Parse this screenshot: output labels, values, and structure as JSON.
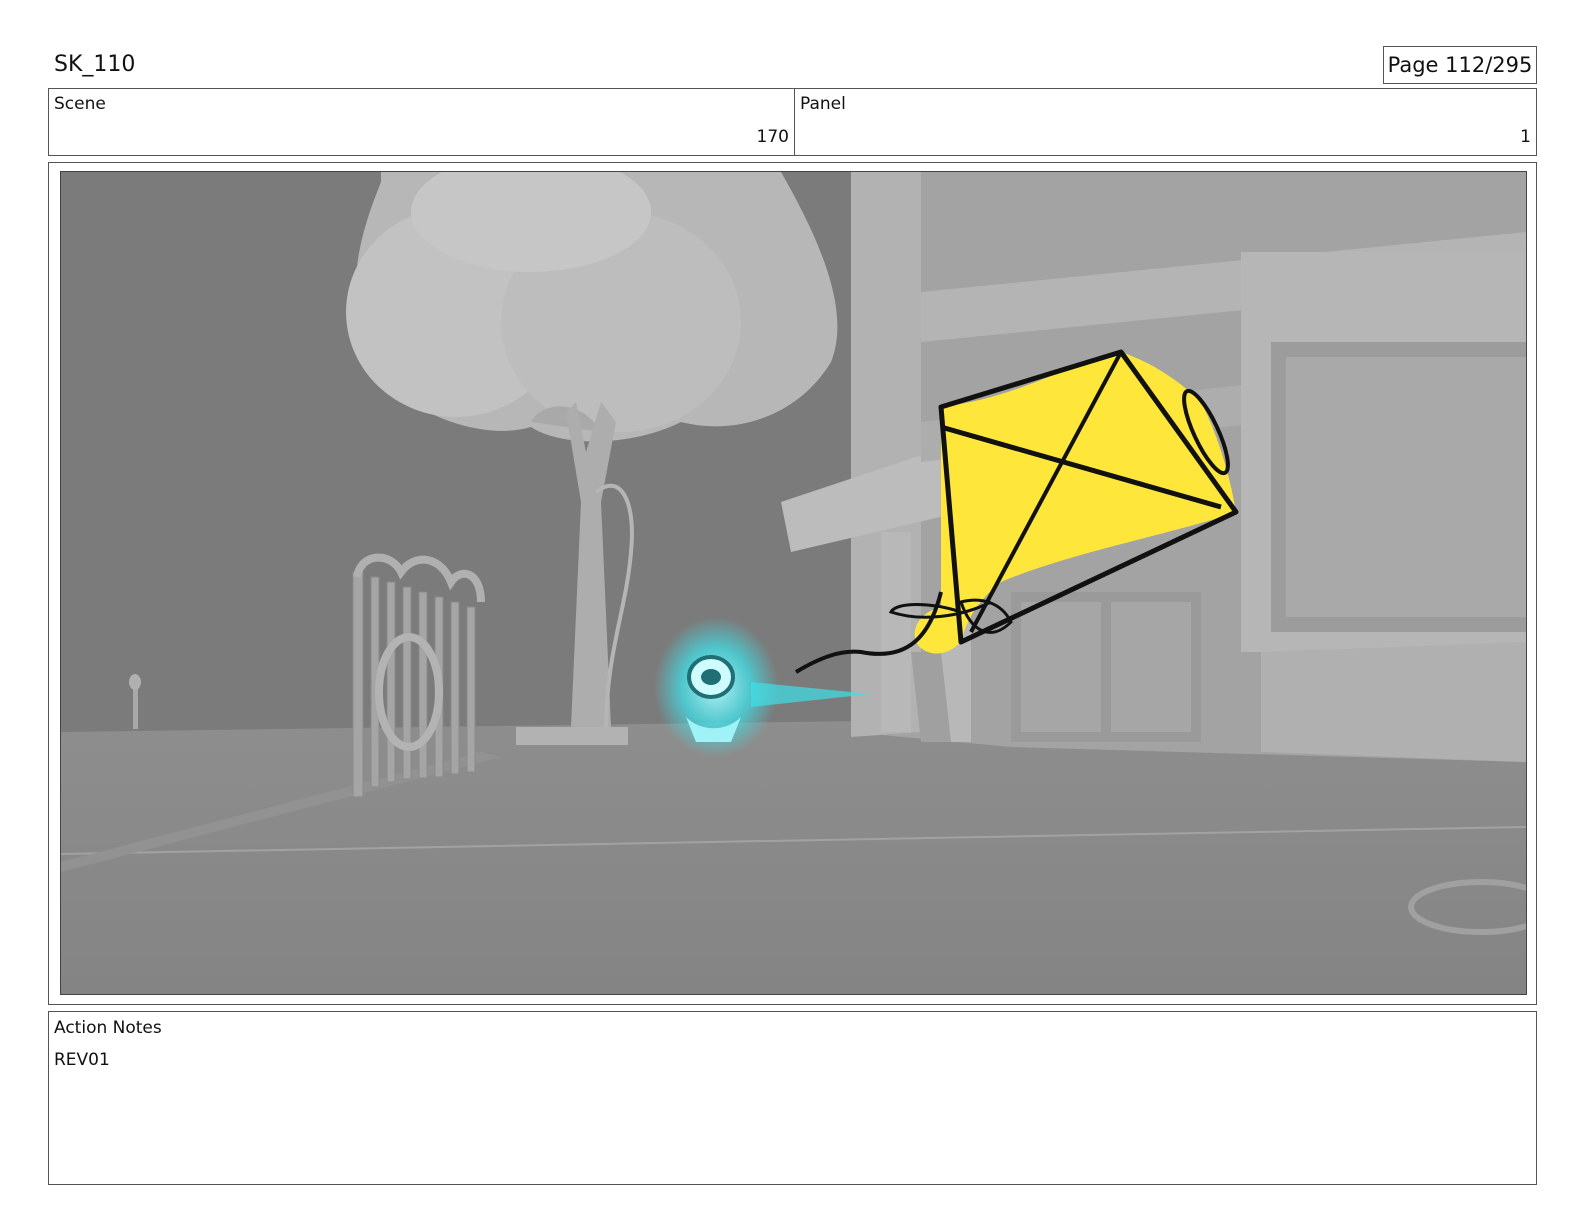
{
  "header": {
    "title": "SK_110",
    "page": "Page 112/295"
  },
  "meta": {
    "scene_label": "Scene",
    "scene_value": "170",
    "panel_label": "Panel",
    "panel_value": "1"
  },
  "notes": {
    "label": "Action Notes",
    "text": "REV01"
  },
  "colors": {
    "kite": "#ffe63b",
    "glow": "#3fe0e8"
  }
}
